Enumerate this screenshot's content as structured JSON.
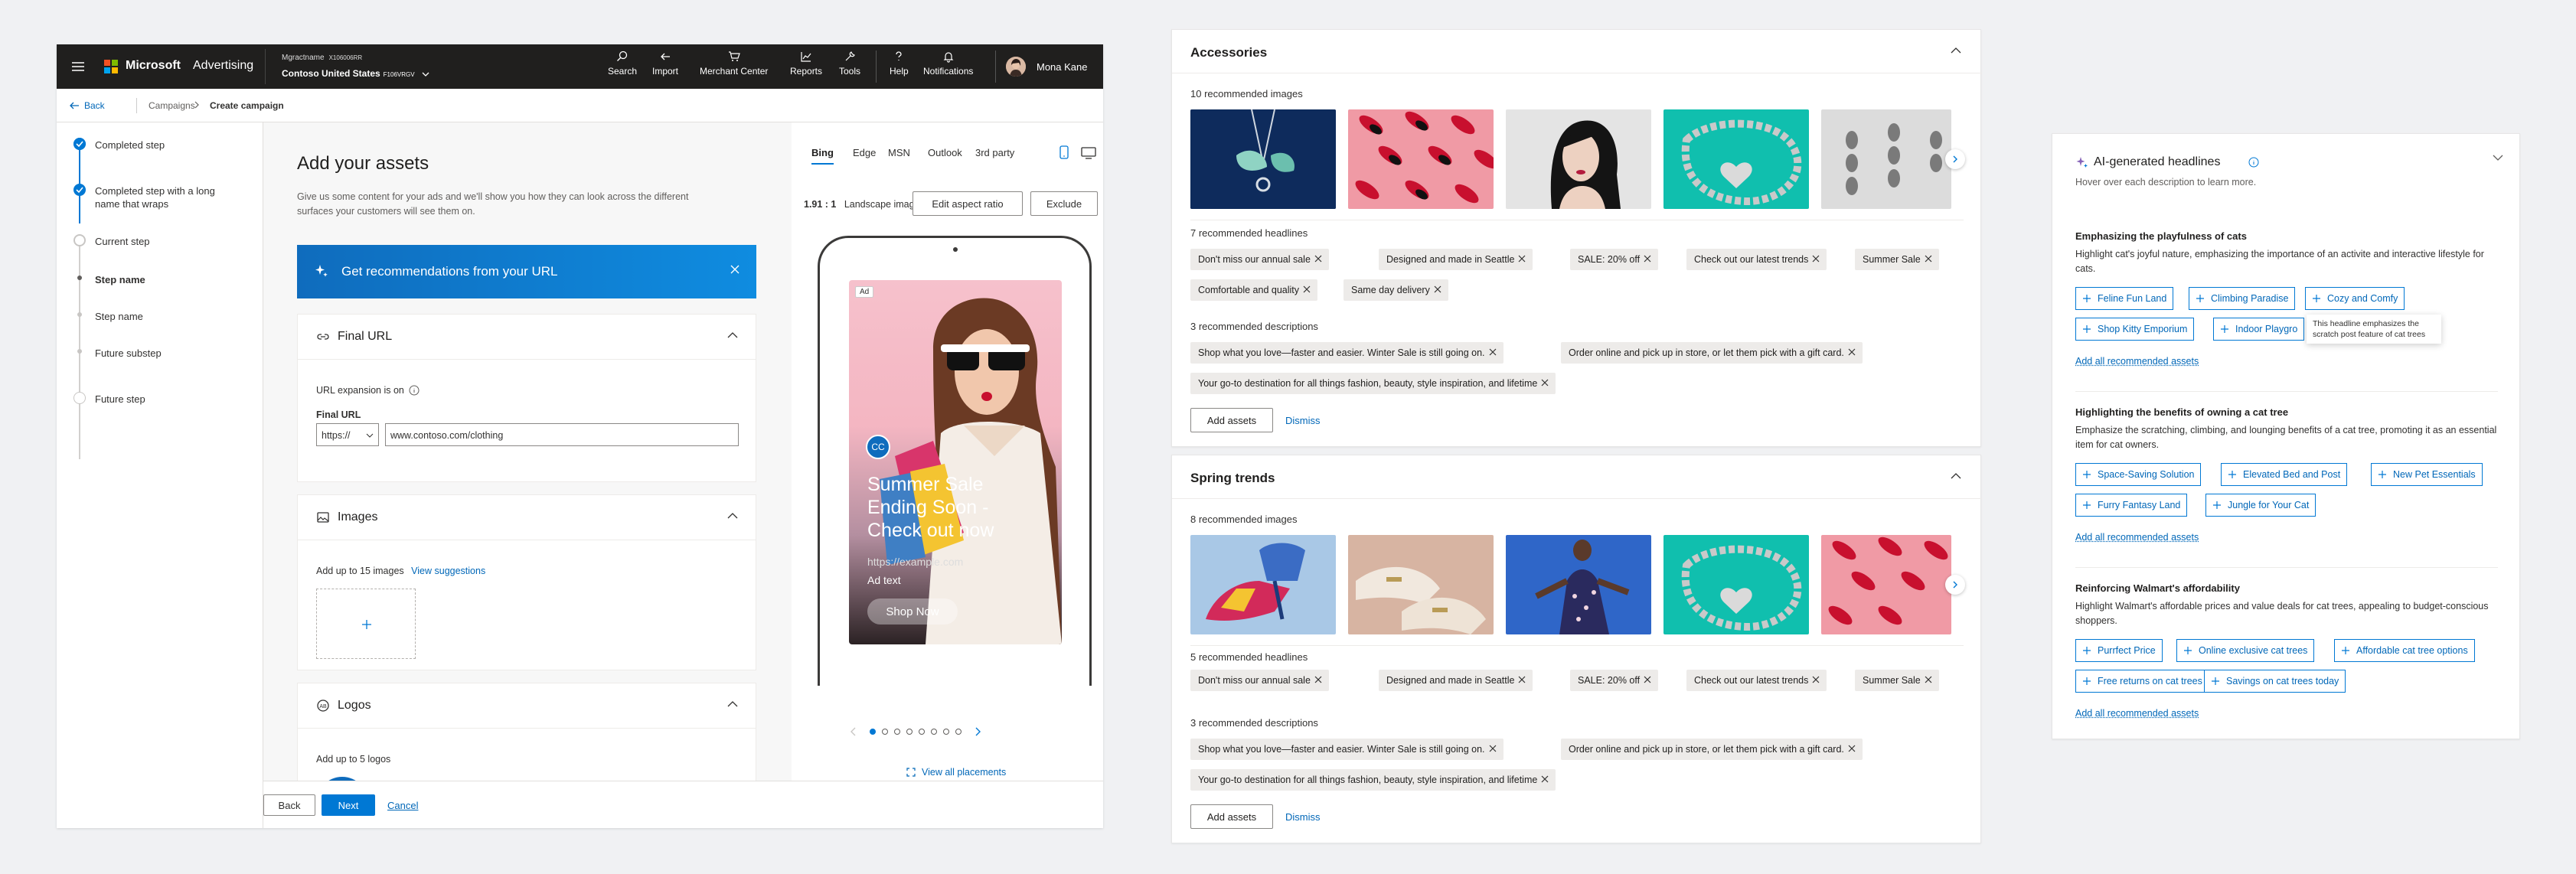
{
  "topbar": {
    "brand": "Microsoft",
    "product": "Advertising",
    "account_name": "Mgractname",
    "account_id": "X106006RR",
    "customer_name": "Contoso United States",
    "customer_id": "F106VRGV",
    "nav": [
      {
        "label": "Search",
        "icon": "search-icon"
      },
      {
        "label": "Import",
        "icon": "import-icon"
      },
      {
        "label": "Merchant Center",
        "icon": "cart-icon"
      },
      {
        "label": "Reports",
        "icon": "chart-icon"
      },
      {
        "label": "Tools",
        "icon": "wrench-icon"
      },
      {
        "label": "Help",
        "icon": "help-icon"
      },
      {
        "label": "Notifications",
        "icon": "bell-icon"
      }
    ],
    "user_name": "Mona Kane"
  },
  "breadcrumb": {
    "back": "Back",
    "campaigns": "Campaigns",
    "current": "Create campaign"
  },
  "stepper": [
    {
      "label": "Completed step",
      "state": "completed"
    },
    {
      "label": "Completed step with a long name that wraps",
      "state": "completed"
    },
    {
      "label": "Current step",
      "state": "current"
    },
    {
      "label": "Step name",
      "state": "substep-active"
    },
    {
      "label": "Step name",
      "state": "substep"
    },
    {
      "label": "Future substep",
      "state": "substep"
    },
    {
      "label": "Future step",
      "state": "future"
    }
  ],
  "main": {
    "title": "Add your assets",
    "intro": "Give us some content for your ads and we'll show you how they can look across the different surfaces your customers will see them on.",
    "reco_banner": "Get recommendations from your URL",
    "final_url": {
      "title": "Final URL",
      "expansion": "URL expansion is on",
      "field_label": "Final URL",
      "protocol": "https://",
      "value": "www.contoso.com/clothing"
    },
    "images": {
      "title": "Images",
      "hint": "Add up to 15 images",
      "link": "View suggestions"
    },
    "logos": {
      "title": "Logos",
      "hint": "Add up to 5 logos",
      "logo_text": "CC"
    }
  },
  "footer": {
    "back": "Back",
    "next": "Next",
    "cancel": "Cancel"
  },
  "preview": {
    "tabs": [
      "Bing",
      "Edge",
      "MSN",
      "Outlook",
      "3rd party"
    ],
    "active_tab": "Bing",
    "ratio": "1.91 : 1",
    "ratio_label": "Landscape image",
    "edit_aspect": "Edit aspect ratio",
    "exclude": "Exclude",
    "ad_badge": "Ad",
    "ad_logo": "CC",
    "ad_headline": "Summer Sale Ending Soon - Check out now",
    "ad_url": "https://example.com",
    "ad_text": "Ad text",
    "ad_cta": "Shop Now",
    "pager_total": 8,
    "pager_active": 1,
    "view_all": "View all placements"
  },
  "accessories": {
    "title": "Accessories",
    "images_count": "10 recommended images",
    "headlines_count": "7 recommended headlines",
    "headlines": [
      "Don't miss our annual sale",
      "Designed and made in Seattle",
      "SALE: 20% off",
      "Check out our latest trends",
      "Summer Sale",
      "Comfortable and quality",
      "Same day delivery"
    ],
    "descriptions_count": "3 recommended descriptions",
    "descriptions": [
      "Shop what you love—faster and easier. Winter Sale is still going on.",
      "Order online and pick up in store, or let them pick with a gift card.",
      "Your go-to destination for all things fashion, beauty, style inspiration, and lifetime"
    ],
    "add_assets": "Add assets",
    "dismiss": "Dismiss"
  },
  "spring": {
    "title": "Spring trends",
    "images_count": "8 recommended images",
    "headlines_count": "5 recommended headlines",
    "headlines": [
      "Don't miss our annual sale",
      "Designed and made in Seattle",
      "SALE: 20% off",
      "Check out our latest trends",
      "Summer Sale"
    ],
    "descriptions_count": "3 recommended descriptions",
    "descriptions": [
      "Shop what you love—faster and easier. Winter Sale is still going on.",
      "Order online and pick up in store, or let them pick with a gift card.",
      "Your go-to destination for all things fashion, beauty, style inspiration, and lifetime"
    ],
    "add_assets": "Add assets",
    "dismiss": "Dismiss"
  },
  "ai": {
    "title": "AI-generated headlines",
    "subtitle": "Hover over each description to learn more.",
    "tooltip": "This headline emphasizes the scratch post feature of cat trees",
    "add_all": "Add all recommended assets",
    "sections": [
      {
        "title": "Emphasizing the playfulness of cats",
        "desc": "Highlight cat's joyful nature, emphasizing the importance of an activite and interactive lifestyle for cats.",
        "chips": [
          "Feline Fun Land",
          "Climbing Paradise",
          "Cozy and Comfy",
          "Shop Kitty Emporium",
          "Indoor Playgro"
        ]
      },
      {
        "title": "Highlighting the benefits of owning a cat tree",
        "desc": "Emphasize the scratching, climbing, and lounging benefits of a cat tree, promoting it as an essential item for cat owners.",
        "chips": [
          "Space-Saving Solution",
          "Elevated Bed and Post",
          "New Pet Essentials",
          "Furry Fantasy Land",
          "Jungle for Your Cat"
        ]
      },
      {
        "title": "Reinforcing Walmart's affordability",
        "desc": "Highlight Walmart's affordable prices and value deals for cat trees, appealing to budget-conscious shoppers.",
        "chips": [
          "Purrfect Price",
          "Online exclusive cat trees",
          "Affordable cat tree options",
          "Free returns on cat trees",
          "Savings on cat trees today"
        ]
      }
    ]
  },
  "colors": {
    "accent": "#0078d4",
    "topbar": "#201f1e",
    "link": "#0067b8"
  }
}
